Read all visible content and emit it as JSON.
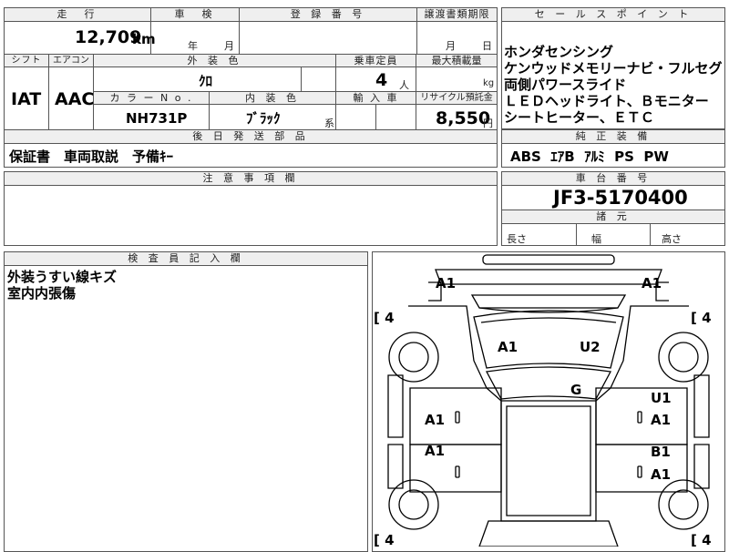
{
  "top_block": {
    "mileage_label": "走　行",
    "mileage_value": "12,709",
    "mileage_unit": "km",
    "inspection_label": "車　検",
    "inspection_year": "年",
    "inspection_month": "月",
    "registration_label": "登 録 番 号",
    "transfer_label": "譲渡書類期限",
    "transfer_month": "月",
    "transfer_day": "日",
    "shift_label": "シフト",
    "shift_value": "IAT",
    "aircon_label": "エアコン",
    "aircon_value": "AAC",
    "ext_color_label": "外 装 色",
    "ext_color_value": "ｸﾛ",
    "capacity_label": "乗車定員",
    "capacity_value": "4",
    "capacity_unit": "人",
    "max_load_label": "最大積載量",
    "max_load_unit": "kg",
    "color_no_label": "カ ラ ー N o .",
    "color_no_value": "NH731P",
    "int_color_label": "内 装 色",
    "int_color_value": "ﾌﾞﾗｯｸ",
    "int_color_suffix": "系",
    "import_label": "輸 入 車",
    "recycle_label": "リサイクル預託金",
    "recycle_value": "8,550",
    "recycle_unit": "円",
    "later_parts_label": "後 日 発 送 部 品",
    "later_parts_value": "保証書　車両取説　予備ｷｰ"
  },
  "sales_points": {
    "label": "セ ー ル ス ポ イ ン ト",
    "lines": [
      "ホンダセンシング",
      "ケンウッドメモリーナビ・フルセグ",
      "両側パワースライド",
      "ＬＥＤヘッドライト、Ｂモニター",
      "シートヒーター、ＥＴＣ"
    ]
  },
  "genuine_equipment": {
    "label": "純 正 装 備",
    "value": "ABS  ｴｱB  ｱﾙﾐ  PS  PW"
  },
  "notes": {
    "label": "注 意 事 項 欄"
  },
  "chassis": {
    "label": "車 台 番 号",
    "value": "JF3-5170400",
    "dims_label": "諸 元",
    "length_label": "長さ",
    "width_label": "幅",
    "height_label": "高さ"
  },
  "inspector": {
    "label": "検 査 員 記 入 欄",
    "lines": [
      "外装うすい線キズ",
      "室内内張傷"
    ]
  },
  "diagram": {
    "tire_marks": [
      {
        "bracket": "[",
        "value": "4"
      },
      {
        "bracket": "[",
        "value": "4"
      },
      {
        "bracket": "[",
        "value": "4"
      },
      {
        "bracket": "[",
        "value": "4"
      }
    ],
    "damage": {
      "front_left_corner": "A1",
      "front_right_corner": "A1",
      "hood_left": "A1",
      "hood_right": "U2",
      "roof": "G",
      "front_left_door": "A1",
      "front_right_door_top": "U1",
      "front_right_door": "A1",
      "rear_left_door": "A1",
      "rear_right_door_top": "B1",
      "rear_right_door": "A1"
    }
  }
}
